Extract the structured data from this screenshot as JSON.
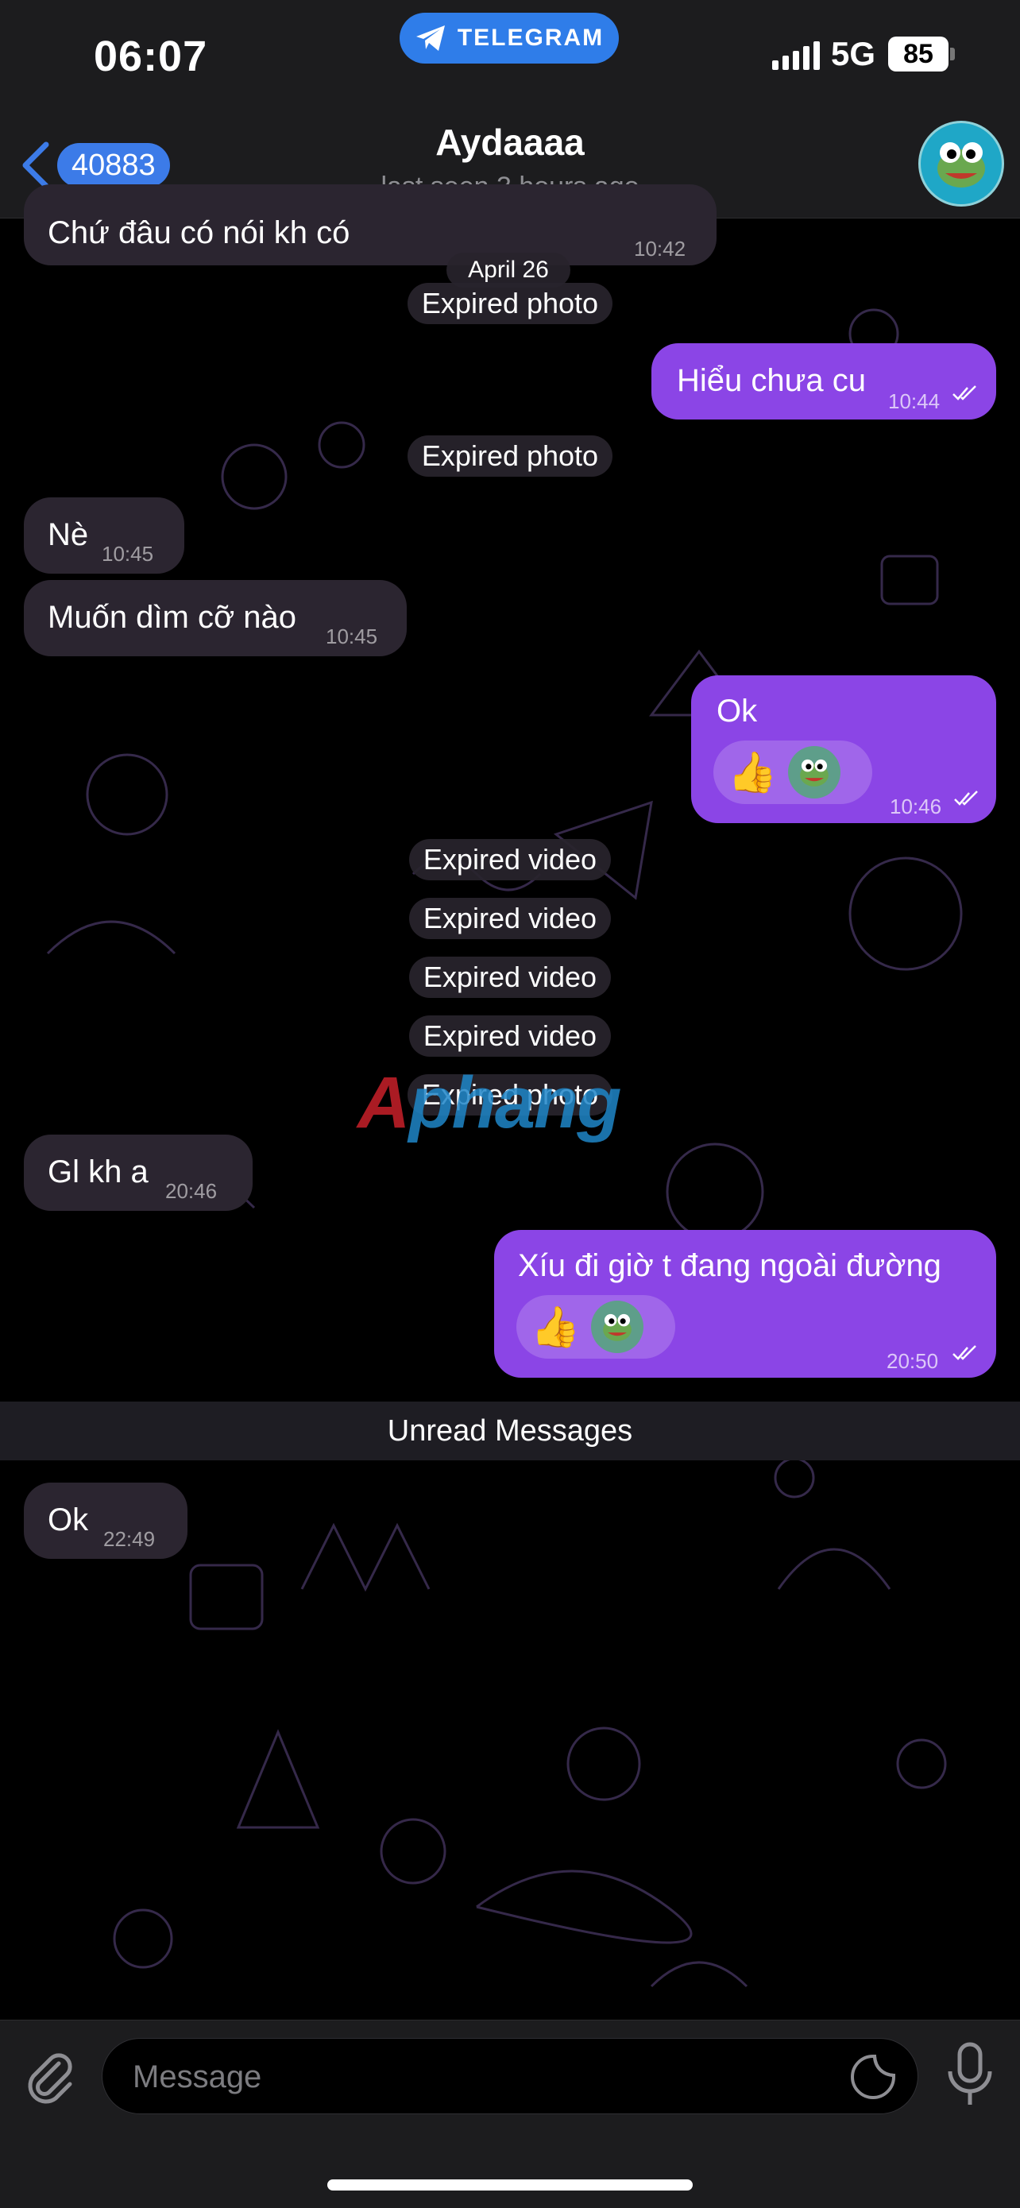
{
  "status_bar": {
    "time": "06:07",
    "app_pill": "TELEGRAM",
    "network": "5G",
    "battery": "85"
  },
  "header": {
    "back_count": "40883",
    "title": "Aydaaaa",
    "subtitle": "last seen 3 hours ago"
  },
  "messages": [
    {
      "id": "m0",
      "dir": "in",
      "text": "Chứ đâu có nói kh có",
      "time": "10:42"
    },
    {
      "id": "m1",
      "dir": "out",
      "text": "Hiểu chưa cu",
      "time": "10:44"
    },
    {
      "id": "m2",
      "dir": "in",
      "text": "Nè",
      "time": "10:45"
    },
    {
      "id": "m3",
      "dir": "in",
      "text": "Muốn dìm cỡ nào",
      "time": "10:45"
    },
    {
      "id": "m4",
      "dir": "out",
      "text": "Ok",
      "time": "10:46",
      "reaction": "👍"
    },
    {
      "id": "m5",
      "dir": "in",
      "text": "Gl kh a",
      "time": "20:46"
    },
    {
      "id": "m6",
      "dir": "out",
      "text": "Xíu đi giờ t đang ngoài đường",
      "time": "20:50",
      "reaction": "👍"
    },
    {
      "id": "m7",
      "dir": "in",
      "text": "Ok",
      "time": "22:49"
    }
  ],
  "date_header": "April 26",
  "service": [
    "Expired photo",
    "Expired photo",
    "Expired video",
    "Expired video",
    "Expired video",
    "Expired video",
    "Expired photo"
  ],
  "unread_label": "Unread Messages",
  "watermark": {
    "part1": "A",
    "part2": "phang"
  },
  "input": {
    "placeholder": "Message"
  },
  "colors": {
    "outgoing_bubble": "#8b45e6",
    "incoming_bubble": "#2b2530",
    "accent": "#2f7de9"
  }
}
